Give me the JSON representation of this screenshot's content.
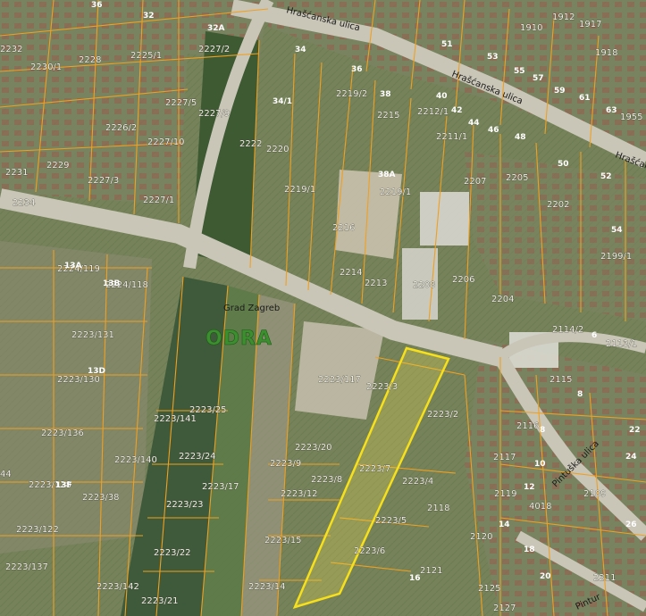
{
  "map": {
    "city": "Grad Zagreb",
    "river": "ODRA",
    "highlight_color": "#f7e01a",
    "parcel_line_color": "#f0a020",
    "streets": [
      {
        "id": "hrascanska-1",
        "text": "Hrašćanska ulica"
      },
      {
        "id": "hrascanska-2",
        "text": "Hrašćanska ulica"
      },
      {
        "id": "hrascanska-3",
        "text": "Hrašćan"
      },
      {
        "id": "pintusska",
        "text": "Pintuška ulica"
      },
      {
        "id": "pintur",
        "text": "Pintur"
      }
    ],
    "parcels": [
      "2232",
      "2230/1",
      "2228",
      "2225/1",
      "2227/2",
      "2227/5",
      "2227/9",
      "2226/2",
      "2227/10",
      "2222",
      "2220",
      "2231",
      "2229",
      "2227/3",
      "2227/1",
      "2234",
      "2219/1",
      "2219/2",
      "2215",
      "2212/1",
      "2211/1",
      "2207",
      "2205",
      "2219/1",
      "2216",
      "2214",
      "2213",
      "2208",
      "2206",
      "2204",
      "2202",
      "2199/1",
      "2114/2",
      "2113/1",
      "2115",
      "2116",
      "2117",
      "2119",
      "4018",
      "2109",
      "2211",
      "2121",
      "2125",
      "2127",
      "2118",
      "2120",
      "2224/119",
      "2224/118",
      "2223/131",
      "2223/130",
      "2223/136",
      "2223/140",
      "2223/141",
      "2223/25",
      "2223/24",
      "2223/17",
      "2223/23",
      "2223/22",
      "2223/21",
      "2223/142",
      "2223/137",
      "2223/122",
      "2223/128",
      "2223/38",
      "2223/117",
      "2223/3",
      "2223/2",
      "2223/7",
      "2223/4",
      "2223/5",
      "2223/6",
      "2223/20",
      "2223/9",
      "2223/12",
      "2223/8",
      "2223/15",
      "2223/14",
      "1910",
      "1912",
      "1917",
      "1918",
      "1955",
      "44",
      "4018"
    ],
    "house_numbers": [
      "36",
      "32",
      "32A",
      "34",
      "34/1",
      "36",
      "38",
      "38A",
      "40",
      "42",
      "44",
      "46",
      "48",
      "50",
      "51",
      "53",
      "55",
      "57",
      "59",
      "61",
      "63",
      "52",
      "54",
      "13A",
      "13B",
      "13D",
      "13F",
      "6",
      "8",
      "8",
      "10",
      "12",
      "14",
      "16",
      "18",
      "20",
      "22",
      "24",
      "26"
    ]
  }
}
